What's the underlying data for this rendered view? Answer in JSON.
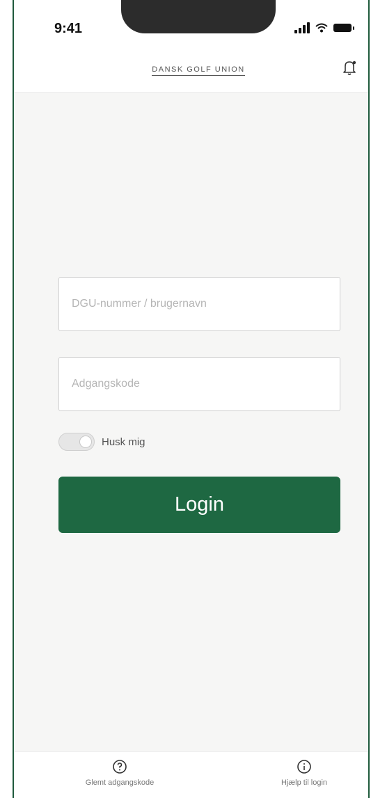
{
  "status": {
    "time": "9:41"
  },
  "header": {
    "logo_text": "DANSK GOLF UNION"
  },
  "form": {
    "username_placeholder": "DGU-nummer / brugernavn",
    "password_placeholder": "Adgangskode",
    "remember_label": "Husk mig",
    "login_label": "Login"
  },
  "bottom": {
    "forgot_label": "Glemt adgangskode",
    "help_label": "Hjælp til login"
  },
  "colors": {
    "primary": "#1e6842",
    "frame": "#1f5a3c"
  }
}
